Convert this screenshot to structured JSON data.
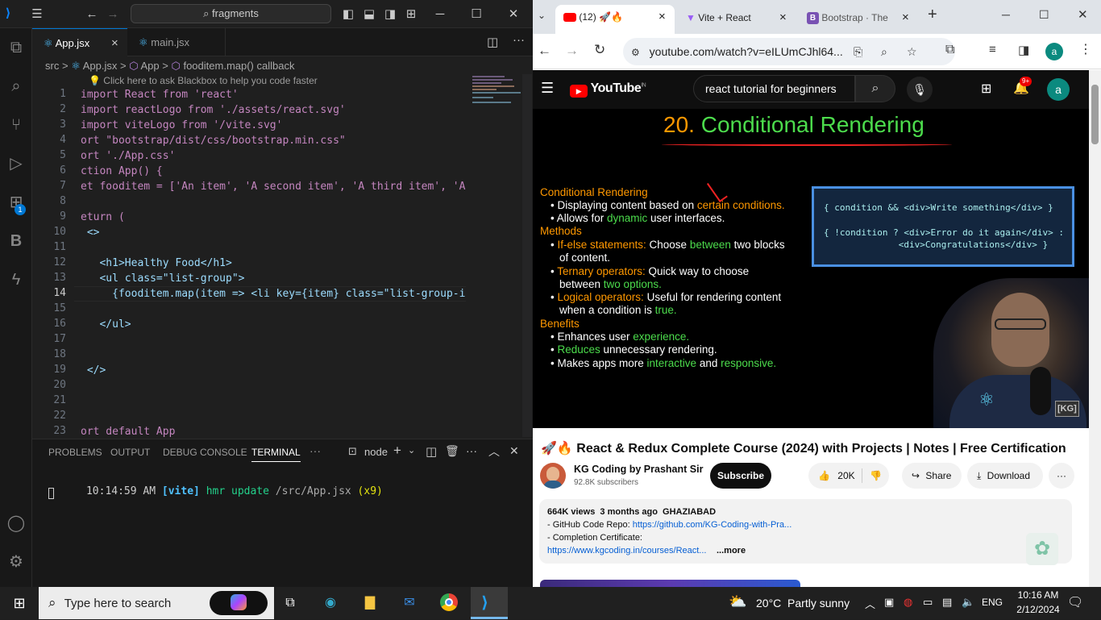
{
  "vscode": {
    "search_label": "fragments",
    "tabs": [
      {
        "label": "App.jsx",
        "close": "×"
      },
      {
        "label": "main.jsx"
      }
    ],
    "breadcrumb": [
      "src",
      ">",
      "App.jsx",
      ">",
      "App",
      ">",
      "fooditem.map() callback"
    ],
    "hint": "💡 Click here to ask Blackbox to help you code faster",
    "line_numbers": [
      "1",
      "2",
      "3",
      "4",
      "5",
      "6",
      "7",
      "8",
      "9",
      "10",
      "11",
      "12",
      "13",
      "14",
      "15",
      "16",
      "17",
      "18",
      "19",
      "20",
      "21",
      "22",
      "23"
    ],
    "code_lines": [
      "import React from 'react'",
      "import reactLogo from './assets/react.svg'",
      "import viteLogo from '/vite.svg'",
      "ort \"bootstrap/dist/css/bootstrap.min.css\"",
      "ort './App.css'",
      "ction App() {",
      "et fooditem = ['An item', 'A second item', 'A third item', 'A",
      "",
      "eturn (",
      " <>",
      "",
      "   <h1>Healthy Food</h1>",
      "   <ul class=\"list-group\">",
      "     {fooditem.map(item => <li key={item} class=\"list-group-it",
      "",
      "   </ul>",
      "",
      "",
      " </>",
      "",
      "",
      "",
      "ort default App"
    ],
    "activity_badge": "1",
    "panel_tabs": [
      "PROBLEMS",
      "OUTPUT",
      "DEBUG CONSOLE",
      "TERMINAL"
    ],
    "panel_more": "···",
    "terminal_name": "node",
    "terminal": {
      "time": "10:14:59 AM",
      "tag": "[vite]",
      "msg": "hmr update",
      "path": "/src/App.jsx",
      "count": "(x9)"
    }
  },
  "chrome": {
    "tabs": [
      {
        "label": "(12) 🚀🔥",
        "close": "×"
      },
      {
        "label": "Vite + React",
        "close": "×"
      },
      {
        "label": "Bootstrap · The",
        "close": "×"
      }
    ],
    "new_tab": "+",
    "url": "youtube.com/watch?v=eILUmCJhl64...",
    "profile": "a"
  },
  "youtube": {
    "logo": "YouTube",
    "logo_sup": "IN",
    "search_value": "react tutorial for beginners",
    "notif_count": "9+",
    "avatar": "a",
    "slide": {
      "title_num": "20.",
      "title_text": "Conditional Rendering",
      "heading1": "Conditional Rendering",
      "b1_a": "Displaying content based on ",
      "b1_b": "certain conditions.",
      "b2_a": "Allows for ",
      "b2_b": "dynamic",
      "b2_c": " user interfaces.",
      "heading2": "Methods",
      "m1_a": "If-else statements:",
      "m1_b": " Choose ",
      "m1_c": "between",
      "m1_d": " two blocks",
      "m1_e": "of content.",
      "m2_a": "Ternary operators:",
      "m2_b": " Quick way to choose",
      "m2_c": "between ",
      "m2_d": "two options.",
      "m3_a": "Logical operators:",
      "m3_b": " Useful for rendering content",
      "m3_c": "when a condition is ",
      "m3_d": "true.",
      "heading3": "Benefits",
      "n1_a": "Enhances user ",
      "n1_b": "experience.",
      "n2_a": "Reduces",
      "n2_b": " unnecessary rendering.",
      "n3_a": "Makes apps more ",
      "n3_b": "interactive",
      "n3_c": " and ",
      "n3_d": "responsive.",
      "code1": "{ condition && <div>Write something</div> }",
      "code2": "{ !condition ? <div>Error do it again</div> :",
      "code3": "              <div>Congratulations</div> }",
      "watermark": "[KG]"
    },
    "video_title": "🚀🔥 React & Redux Complete Course (2024) with Projects | Notes | Free Certification",
    "channel": "KG Coding by Prashant Sir",
    "subscribers": "92.8K subscribers",
    "subscribe": "Subscribe",
    "likes": "20K",
    "share": "Share",
    "download": "Download",
    "views_line": "664K views  3 months ago  GHAZIABAD",
    "desc1": "- GitHub Code Repo: ",
    "desc1_link": "https://github.com/KG-Coding-with-Pra...",
    "desc2": "- Completion Certificate:",
    "desc3_link": "https://www.kgcoding.in/courses/React...",
    "more": "...more"
  },
  "taskbar": {
    "search_placeholder": "Type here to search",
    "weather": "20°C  Partly sunny",
    "lang": "ENG",
    "time": "10:16 AM",
    "date": "2/12/2024"
  }
}
